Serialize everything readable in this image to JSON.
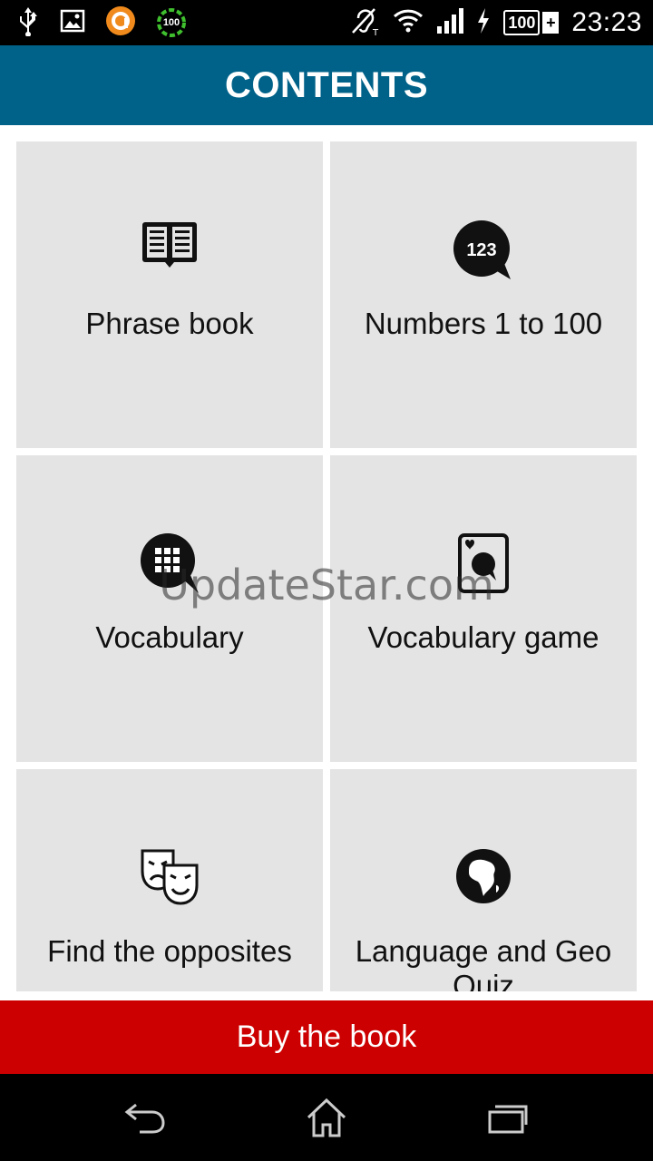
{
  "statusbar": {
    "time": "23:23",
    "battery_level": "100",
    "battery_plus": "+",
    "icons": [
      "usb-icon",
      "image-icon",
      "orange-app-icon",
      "progress-circle-icon",
      "hearing-aid-icon",
      "wifi-icon",
      "signal-icon",
      "charging-icon"
    ],
    "progress_circle_text": "100"
  },
  "header": {
    "title": "CONTENTS"
  },
  "tiles": [
    {
      "label": "Phrase book",
      "icon": "open-book-icon"
    },
    {
      "label": "Numbers 1 to 100",
      "icon": "number-bubble-icon",
      "icon_text": "123"
    },
    {
      "label": "Vocabulary",
      "icon": "grid-bubble-icon"
    },
    {
      "label": "Vocabulary game",
      "icon": "card-icon"
    },
    {
      "label": "Find the opposites",
      "icon": "theater-masks-icon"
    },
    {
      "label": "Language and Geo Quiz",
      "icon": "globe-icon"
    }
  ],
  "buy": {
    "label": "Buy the book"
  },
  "watermark": "UpdateStar.com",
  "colors": {
    "header": "#006289",
    "buy": "#cc0000",
    "tile": "#e4e4e4"
  }
}
